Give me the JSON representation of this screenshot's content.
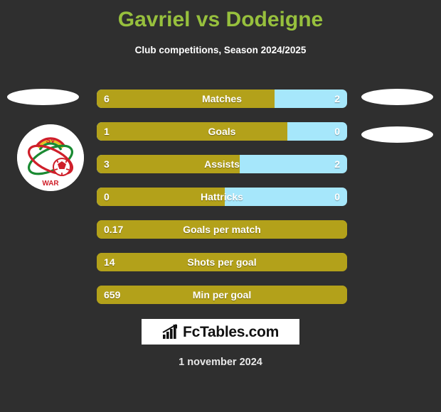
{
  "header": {
    "title": "Gavriel vs Dodeigne",
    "subtitle": "Club competitions, Season 2024/2025",
    "title_color": "#97c03d",
    "subtitle_color": "#ffffff"
  },
  "theme": {
    "background": "#2f2f2f",
    "home_bar_color": "#b3a11a",
    "away_bar_color": "#a6e7fb",
    "value_text_color": "#ffffff"
  },
  "left_player": {
    "photo_state": "missing-image",
    "club_badge_name": "sv-wars-club-badge",
    "badge_top_text": "SV",
    "badge_bottom_text": "WAR"
  },
  "right_player": {
    "photo_state": "missing-image",
    "badge_state": "missing-image"
  },
  "chart_data": {
    "type": "bar",
    "title": "Gavriel vs Dodeigne",
    "subtitle": "Club competitions, Season 2024/2025",
    "orientation": "horizontal-diverging",
    "series": [
      {
        "name": "Gavriel",
        "color": "#b3a11a"
      },
      {
        "name": "Dodeigne",
        "color": "#a6e7fb"
      }
    ],
    "categories": [
      "Matches",
      "Goals",
      "Assists",
      "Hattricks",
      "Goals per match",
      "Shots per goal",
      "Min per goal"
    ],
    "rows": [
      {
        "label": "Matches",
        "home": "6",
        "away": "2",
        "home_pct": 71,
        "two_sided": true
      },
      {
        "label": "Goals",
        "home": "1",
        "away": "0",
        "home_pct": 76,
        "two_sided": true
      },
      {
        "label": "Assists",
        "home": "3",
        "away": "2",
        "home_pct": 57,
        "two_sided": true
      },
      {
        "label": "Hattricks",
        "home": "0",
        "away": "0",
        "home_pct": 51,
        "two_sided": true
      },
      {
        "label": "Goals per match",
        "home": "0.17",
        "away": "",
        "home_pct": 100,
        "two_sided": false
      },
      {
        "label": "Shots per goal",
        "home": "14",
        "away": "",
        "home_pct": 100,
        "two_sided": false
      },
      {
        "label": "Min per goal",
        "home": "659",
        "away": "",
        "home_pct": 100,
        "two_sided": false
      }
    ]
  },
  "footer": {
    "logo_text": "FcTables.com",
    "logo_icon": "bar-chart-icon",
    "date": "1 november 2024"
  }
}
